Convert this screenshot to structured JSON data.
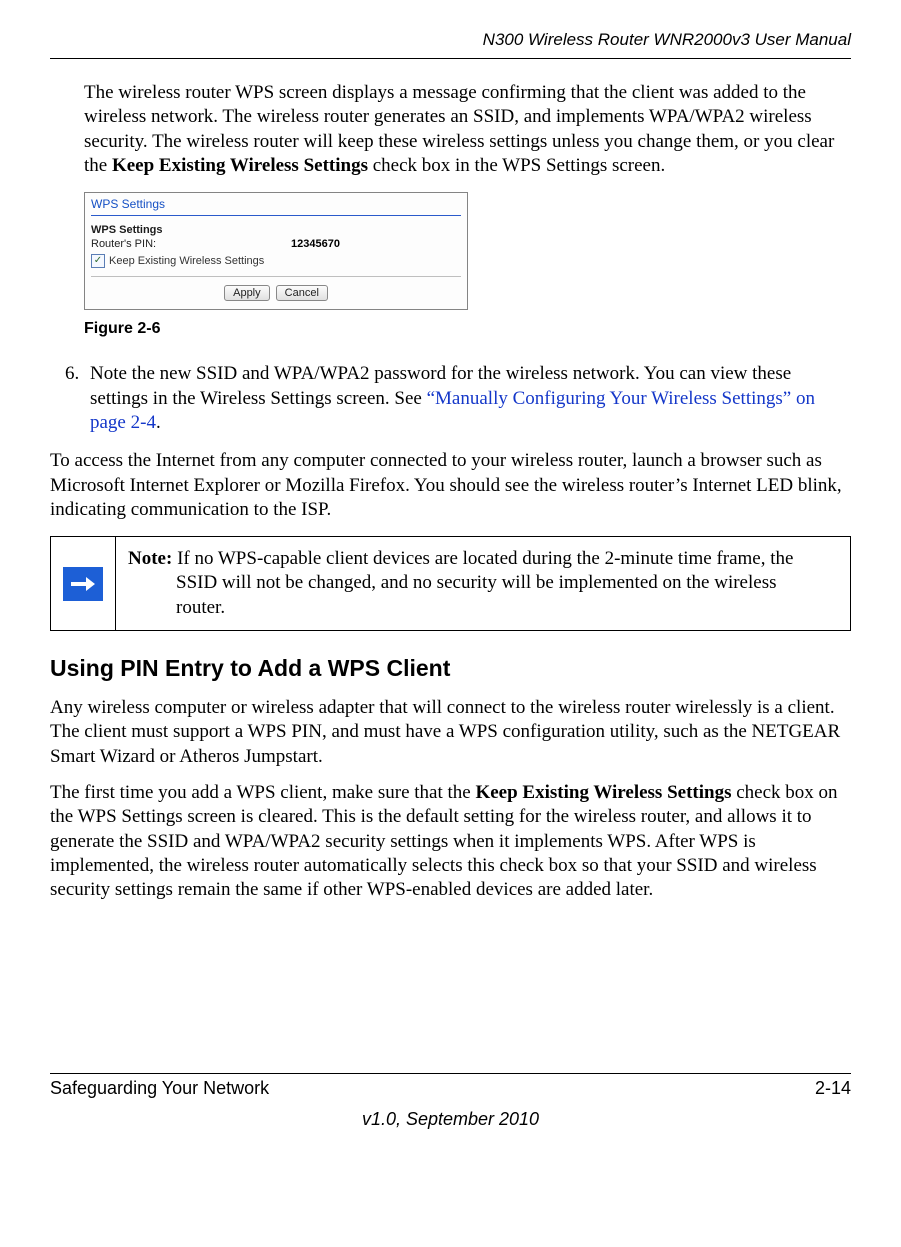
{
  "header": {
    "title": "N300 Wireless Router WNR2000v3 User Manual"
  },
  "para1": {
    "pre": "The wireless router WPS screen displays a message confirming that the client was added to the wireless network. The wireless router generates an SSID, and implements WPA/WPA2 wireless security. The wireless router will keep these wireless settings unless you change them, or you clear the ",
    "bold": "Keep Existing Wireless Settings",
    "post": " check box in the WPS Settings screen."
  },
  "figure": {
    "title": "WPS Settings",
    "subheading": "WPS Settings",
    "pin_label": "Router's PIN:",
    "pin_value": "12345670",
    "keep_label": "Keep Existing Wireless Settings",
    "apply": "Apply",
    "cancel": "Cancel",
    "caption": "Figure 2-6"
  },
  "list6": {
    "marker": "6.",
    "text_a": "Note the new SSID and WPA/WPA2 password for the wireless network. You can view these settings in the Wireless Settings screen. See ",
    "xref": "“Manually Configuring Your Wireless Settings” on page 2-4",
    "text_b": "."
  },
  "para2": "To access the Internet from any computer connected to your wireless router, launch a browser such as Microsoft Internet Explorer or Mozilla Firefox. You should see the wireless router’s Internet LED blink, indicating communication to the ISP.",
  "note": {
    "label": "Note:",
    "line1": " If no WPS-capable client devices are located during the 2-minute time frame, the",
    "line2": "SSID will not be changed, and no security will be implemented on the wireless",
    "line3": "router."
  },
  "section": "Using PIN Entry to Add a WPS Client",
  "para3": "Any wireless computer or wireless adapter that will connect to the wireless router wirelessly is a client. The client must support a WPS PIN, and must have a WPS configuration utility, such as the NETGEAR Smart Wizard or Atheros Jumpstart.",
  "para4": {
    "pre": "The first time you add a WPS client, make sure that the ",
    "bold": "Keep Existing Wireless Settings",
    "post": " check box on the WPS Settings screen is cleared. This is the default setting for the wireless router, and allows it to generate the SSID and WPA/WPA2 security settings when it implements WPS. After WPS is implemented, the wireless router automatically selects this check box so that your SSID and wireless security settings remain the same if other WPS-enabled devices are added later."
  },
  "footer": {
    "left": "Safeguarding Your Network",
    "right": "2-14",
    "center": "v1.0, September 2010"
  }
}
